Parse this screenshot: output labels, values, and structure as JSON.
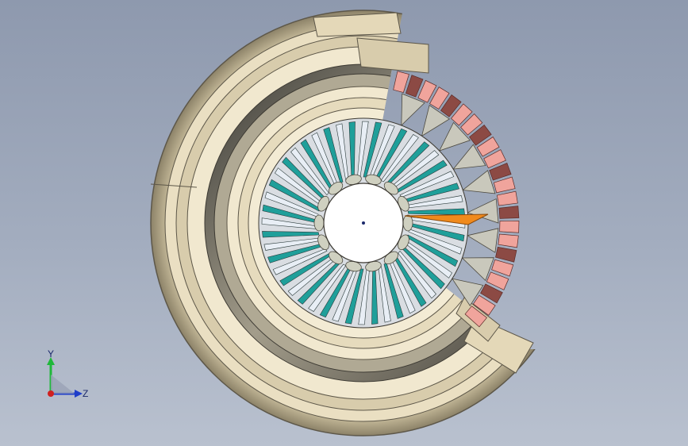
{
  "viewport": {
    "background_top": "#8e99ae",
    "background_bottom": "#b9c1cf"
  },
  "model": {
    "shell_color": "#ece2c6",
    "shell_dark": "#6f6a5f",
    "blade_teal": "#1f9f9a",
    "blade_light": "#e8eef5",
    "vane_pink": "#f0a49c",
    "vane_dark": "#8c4a44",
    "highlight_orange": "#f08a1c",
    "hub_color": "#ffffff",
    "origin_color": "#1b2a6b"
  },
  "triad": {
    "y_label": "Y",
    "z_label": "Z",
    "y_color": "#1fb83a",
    "z_color": "#1f3ec9",
    "origin_color": "#d02020"
  }
}
